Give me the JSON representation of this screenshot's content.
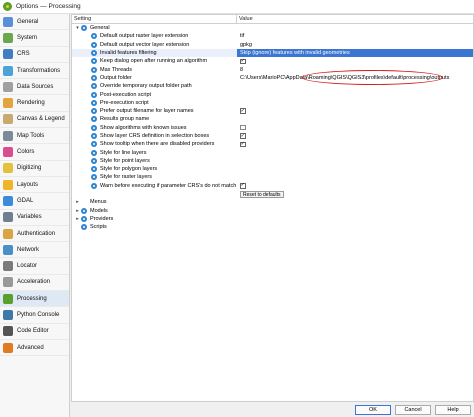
{
  "window": {
    "title": "Options — Processing"
  },
  "sidebar": {
    "items": [
      {
        "label": "General",
        "color": "#5b8fd8"
      },
      {
        "label": "System",
        "color": "#6aa84f"
      },
      {
        "label": "CRS",
        "color": "#3f7fbf"
      },
      {
        "label": "Transformations",
        "color": "#4ba3d8"
      },
      {
        "label": "Data Sources",
        "color": "#a0a0a0"
      },
      {
        "label": "Rendering",
        "color": "#e3a33d"
      },
      {
        "label": "Canvas & Legend",
        "color": "#c9a96e"
      },
      {
        "label": "Map Tools",
        "color": "#7d8a99"
      },
      {
        "label": "Colors",
        "color": "#d94e8f"
      },
      {
        "label": "Digitizing",
        "color": "#e3c13d"
      },
      {
        "label": "Layouts",
        "color": "#f0b429"
      },
      {
        "label": "GDAL",
        "color": "#3b8bd8"
      },
      {
        "label": "Variables",
        "color": "#6f7f8f"
      },
      {
        "label": "Authentication",
        "color": "#d9a441"
      },
      {
        "label": "Network",
        "color": "#4a90c8"
      },
      {
        "label": "Locator",
        "color": "#7a7a7a"
      },
      {
        "label": "Acceleration",
        "color": "#999999"
      },
      {
        "label": "Processing",
        "color": "#5aa02c"
      },
      {
        "label": "Python Console",
        "color": "#3d78a8"
      },
      {
        "label": "Code Editor",
        "color": "#555555"
      },
      {
        "label": "Advanced",
        "color": "#e07b24"
      }
    ],
    "active_index": 17
  },
  "table": {
    "col_setting": "Setting",
    "col_value": "Value",
    "rows": [
      {
        "level": 0,
        "expander": "▾",
        "icon": true,
        "label": "General",
        "value": ""
      },
      {
        "level": 1,
        "icon": true,
        "label": "Default output raster layer extension",
        "value": "tif"
      },
      {
        "level": 1,
        "icon": true,
        "label": "Default output vector layer extension",
        "value": "gpkg"
      },
      {
        "level": 1,
        "icon": true,
        "label": "Invalid features filtering",
        "value": "Skip (ignore) features with invalid geometries",
        "selected": true
      },
      {
        "level": 1,
        "icon": true,
        "label": "Keep dialog open after running an algorithm",
        "checkbox": true,
        "checked": true
      },
      {
        "level": 1,
        "icon": true,
        "label": "Max Threads",
        "value": "8"
      },
      {
        "level": 1,
        "icon": true,
        "label": "Output folder",
        "value": "C:\\Users\\MarioPC\\AppData\\Roaming\\QGIS\\QGIS3\\profiles\\default\\processing\\outputs"
      },
      {
        "level": 1,
        "icon": true,
        "label": "Override temporary output folder path",
        "value": ""
      },
      {
        "level": 1,
        "icon": true,
        "label": "Post-execution script",
        "value": ""
      },
      {
        "level": 1,
        "icon": true,
        "label": "Pre-execution script",
        "value": ""
      },
      {
        "level": 1,
        "icon": true,
        "label": "Prefer output filename for layer names",
        "checkbox": true,
        "checked": true
      },
      {
        "level": 1,
        "icon": true,
        "label": "Results group name",
        "value": ""
      },
      {
        "level": 1,
        "icon": true,
        "label": "Show algorithms with known issues",
        "checkbox": true,
        "checked": false
      },
      {
        "level": 1,
        "icon": true,
        "label": "Show layer CRS definition in selection boxes",
        "checkbox": true,
        "checked": true
      },
      {
        "level": 1,
        "icon": true,
        "label": "Show tooltip when there are disabled providers",
        "checkbox": true,
        "checked": true
      },
      {
        "level": 1,
        "icon": true,
        "label": "Style for line layers",
        "value": ""
      },
      {
        "level": 1,
        "icon": true,
        "label": "Style for point layers",
        "value": ""
      },
      {
        "level": 1,
        "icon": true,
        "label": "Style for polygon layers",
        "value": ""
      },
      {
        "level": 1,
        "icon": true,
        "label": "Style for raster layers",
        "value": ""
      },
      {
        "level": 1,
        "icon": true,
        "label": "Warn before executing if parameter CRS's do not match",
        "checkbox": true,
        "checked": true,
        "button": "Reset to defaults"
      },
      {
        "level": 0,
        "expander": "▸",
        "icon": false,
        "label": "Menus",
        "value": ""
      },
      {
        "level": 0,
        "expander": "▸",
        "icon": true,
        "label": "Models",
        "value": ""
      },
      {
        "level": 0,
        "expander": "▸",
        "icon": true,
        "label": "Providers",
        "value": ""
      },
      {
        "level": 0,
        "expander": "",
        "icon": true,
        "label": "Scripts",
        "value": ""
      }
    ]
  },
  "footer": {
    "ok_label": "OK",
    "cancel_label": "Cancel",
    "help_label": "Help"
  },
  "colors": {
    "selection": "#3a76d2",
    "annotation_ellipse": "#d51a1a",
    "node_icon": "#2f84d0"
  }
}
